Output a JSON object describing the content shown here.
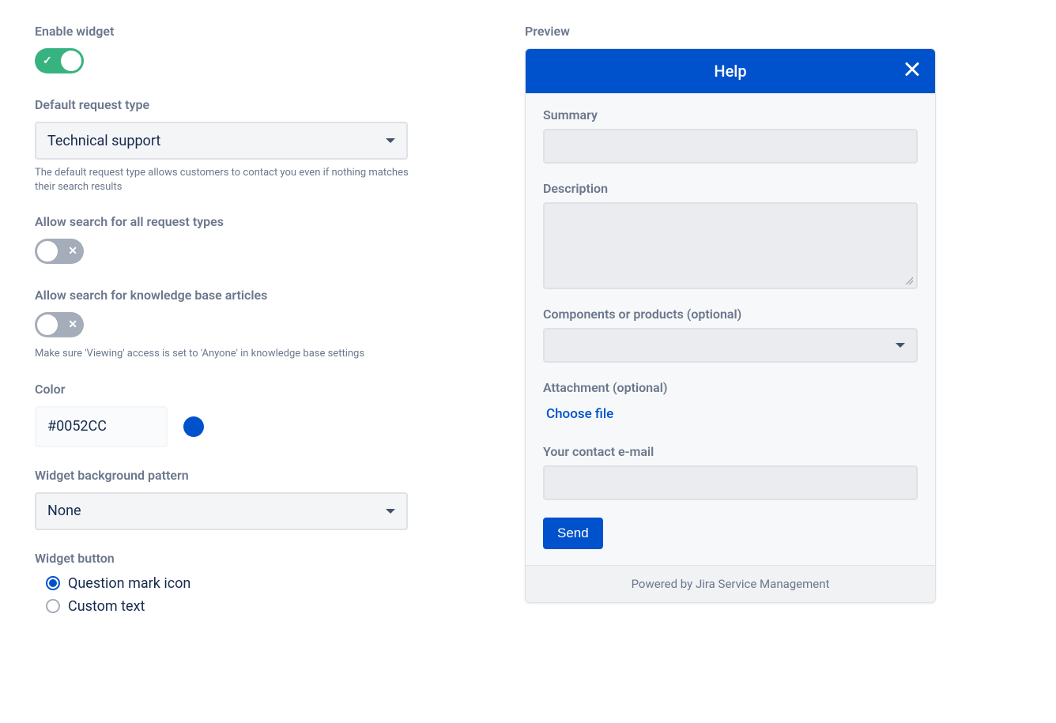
{
  "settings": {
    "enable_widget_label": "Enable widget",
    "enable_widget_on": true,
    "default_request_type_label": "Default request type",
    "default_request_type_value": "Technical support",
    "default_request_type_help": "The default request type allows customers to contact you even if nothing matches their search results",
    "allow_search_request_types_label": "Allow search for all request types",
    "allow_search_request_types_on": false,
    "allow_search_kb_label": "Allow search for knowledge base articles",
    "allow_search_kb_on": false,
    "allow_search_kb_help": "Make sure 'Viewing' access is set to 'Anyone' in knowledge base settings",
    "color_label": "Color",
    "color_value": "#0052CC",
    "bg_pattern_label": "Widget background pattern",
    "bg_pattern_value": "None",
    "widget_button_label": "Widget button",
    "widget_button_options": [
      {
        "label": "Question mark icon",
        "checked": true
      },
      {
        "label": "Custom text",
        "checked": false
      }
    ]
  },
  "preview": {
    "label": "Preview",
    "header_title": "Help",
    "fields": {
      "summary": "Summary",
      "description": "Description",
      "components": "Components or products (optional)",
      "attachment": "Attachment (optional)",
      "choose_file": "Choose file",
      "contact_email": "Your contact e-mail"
    },
    "send_button": "Send",
    "footer": "Powered by Jira Service Management"
  }
}
